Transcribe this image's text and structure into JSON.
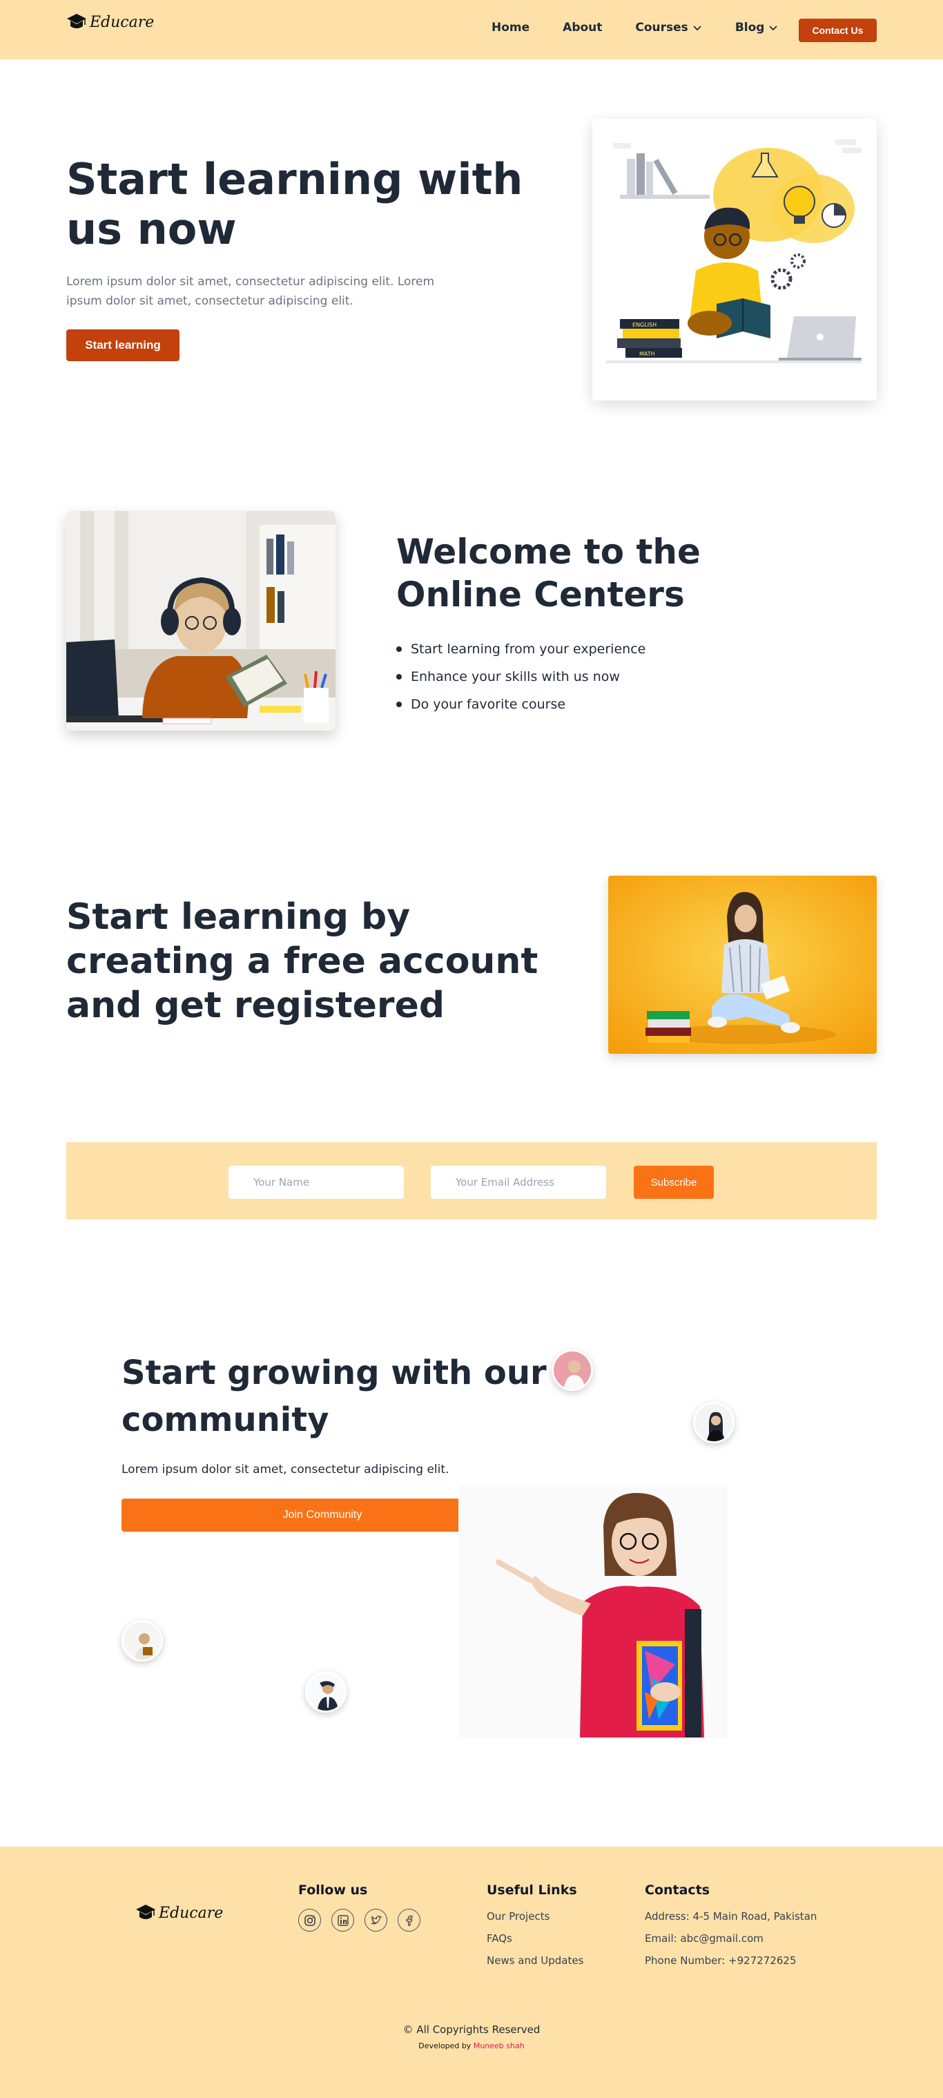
{
  "brand": {
    "name": "Educare"
  },
  "nav": {
    "links": [
      {
        "label": "Home",
        "dropdown": false
      },
      {
        "label": "About",
        "dropdown": false
      },
      {
        "label": "Courses",
        "dropdown": true
      },
      {
        "label": "Blog",
        "dropdown": true
      }
    ],
    "contact_label": "Contact Us"
  },
  "hero": {
    "title": "Start learning with us now",
    "subtitle": "Lorem ipsum dolor sit amet, consectetur adipiscing elit. Lorem ipsum dolor sit amet, consectetur adipiscing elit.",
    "button_label": "Start learning",
    "book_labels": [
      "ENGLISH",
      "MATH"
    ]
  },
  "welcome": {
    "title": "Welcome to the Online Centers",
    "points": [
      "Start learning from your experience",
      "Enhance your skills with us now",
      "Do your favorite course"
    ]
  },
  "register": {
    "title": "Start learning by creating a free account and get registered"
  },
  "subscribe": {
    "name_placeholder": "Your Name",
    "email_placeholder": "Your Email Address",
    "button_label": "Subscribe"
  },
  "community": {
    "title": "Start growing with our community",
    "subtitle": "Lorem ipsum dolor sit amet, consectetur adipiscing elit.",
    "button_label": "Join Community"
  },
  "footer": {
    "follow_heading": "Follow us",
    "social_icons": [
      "instagram-icon",
      "linkedin-icon",
      "twitter-icon",
      "facebook-icon"
    ],
    "links_heading": "Useful Links",
    "links": [
      "Our Projects",
      "FAQs",
      "News and Updates"
    ],
    "contacts_heading": "Contacts",
    "contacts": [
      "Address: 4-5 Main Road, Pakistan",
      "Email: abc@gmail.com",
      "Phone Number: +927272625"
    ],
    "copyright": "© All Copyrights Reserved",
    "developed_prefix": "Developed by ",
    "developer": "Muneeb shah"
  },
  "colors": {
    "nav_bg": "#fde1a9",
    "primary_dark": "#c2410c",
    "primary": "#f97316",
    "text": "#1f2937"
  }
}
